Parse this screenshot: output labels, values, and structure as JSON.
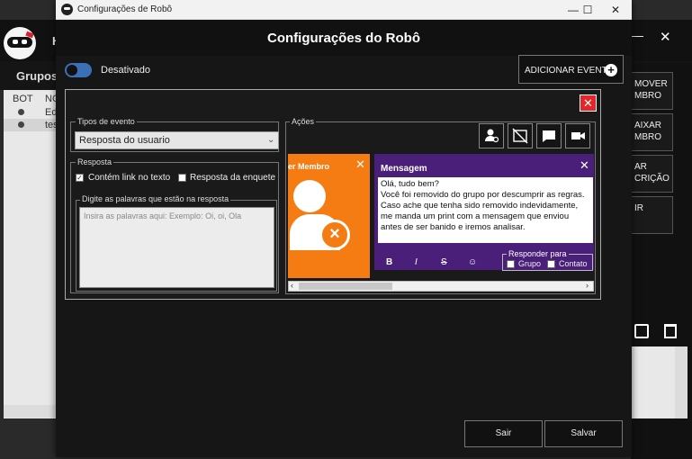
{
  "background": {
    "header_letter": "H",
    "groups_label": "Grupos:",
    "list_headers": [
      "BOT",
      "NO"
    ],
    "list_rows": [
      "Edi",
      "test"
    ],
    "side_buttons": [
      "MOVER MBRO",
      "AIXAR MBRO",
      "AR CRIÇÃO",
      "IR"
    ]
  },
  "window": {
    "titlebar_title": "Configurações de Robô",
    "minimize": "—",
    "maximize": "☐",
    "close": "✕",
    "header_title": "Configurações do Robô",
    "toggle_label": "Desativado",
    "add_event_label": "ADICIONAR EVENTO",
    "add_event_icon": "+",
    "close_panel": "✕"
  },
  "event_types": {
    "legend": "Tipos de evento",
    "selected": "Resposta do usuario"
  },
  "response": {
    "legend": "Resposta",
    "check_link_label": "Contém link no texto",
    "check_link_checked": true,
    "check_poll_label": "Resposta da enquete",
    "check_poll_checked": false,
    "words_legend": "Digite as palavras que estão na resposta",
    "words_placeholder": "Insira as palavras aqui: Exemplo: Oi, oi, Ola"
  },
  "actions": {
    "legend": "Ações",
    "toolbar_icons": [
      "user-settings-icon",
      "no-image-icon",
      "chat-icon",
      "video-icon"
    ],
    "remove_card": {
      "title": "er Membro",
      "close": "✕",
      "color": "#f57c12"
    },
    "message_card": {
      "title": "Mensagem",
      "close": "✕",
      "color": "#4a1f7a",
      "text": "Olá, tudo bem?\nVocê foi removido do grupo por descumprir as regras. Caso ache que tenha sido removido indevidamente, me manda um print com a mensagem que enviou antes de ser banido e iremos analisar.",
      "format_buttons": [
        "B",
        "I",
        "S",
        "☺"
      ],
      "reply_legend": "Responder para",
      "reply_group_label": "Grupo",
      "reply_contact_label": "Contato"
    }
  },
  "footer": {
    "exit_label": "Sair",
    "save_label": "Salvar"
  }
}
